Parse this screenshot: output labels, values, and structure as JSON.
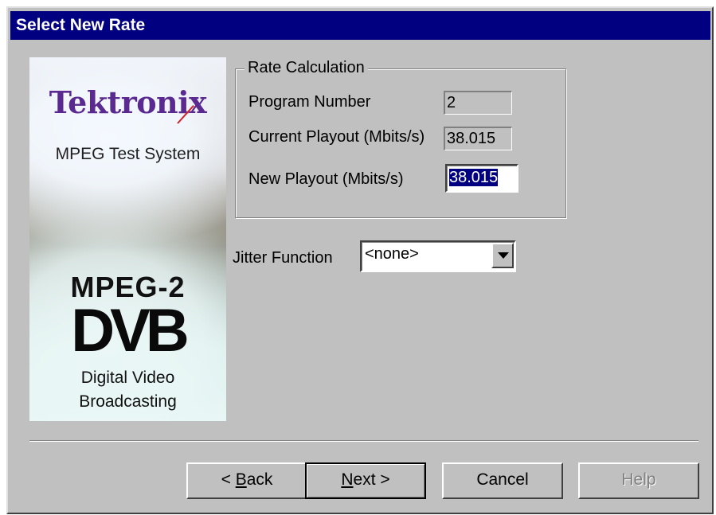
{
  "window": {
    "title": "Select New Rate"
  },
  "banner": {
    "brand": "Tektronix",
    "tagline": "MPEG Test System",
    "mpeg2": "MPEG-2",
    "dvb_logo": "DVB",
    "dvb_line1": "Digital Video",
    "dvb_line2": "Broadcasting"
  },
  "rate_calculation": {
    "legend": "Rate Calculation",
    "program_number_label": "Program Number",
    "program_number_value": "2",
    "current_playout_label": "Current Playout (Mbits/s)",
    "current_playout_value": "38.015",
    "new_playout_label": "New Playout (Mbits/s)",
    "new_playout_value": "38.015"
  },
  "jitter": {
    "label": "Jitter Function",
    "selected": "<none>"
  },
  "buttons": {
    "back_prefix": "< ",
    "back_key": "B",
    "back_rest": "ack",
    "next_key": "N",
    "next_rest": "ext >",
    "cancel": "Cancel",
    "help": "Help"
  },
  "colors": {
    "titlebar": "#000080",
    "face": "#c0c0c0",
    "brand": "#5a2a91",
    "selection": "#000080"
  }
}
